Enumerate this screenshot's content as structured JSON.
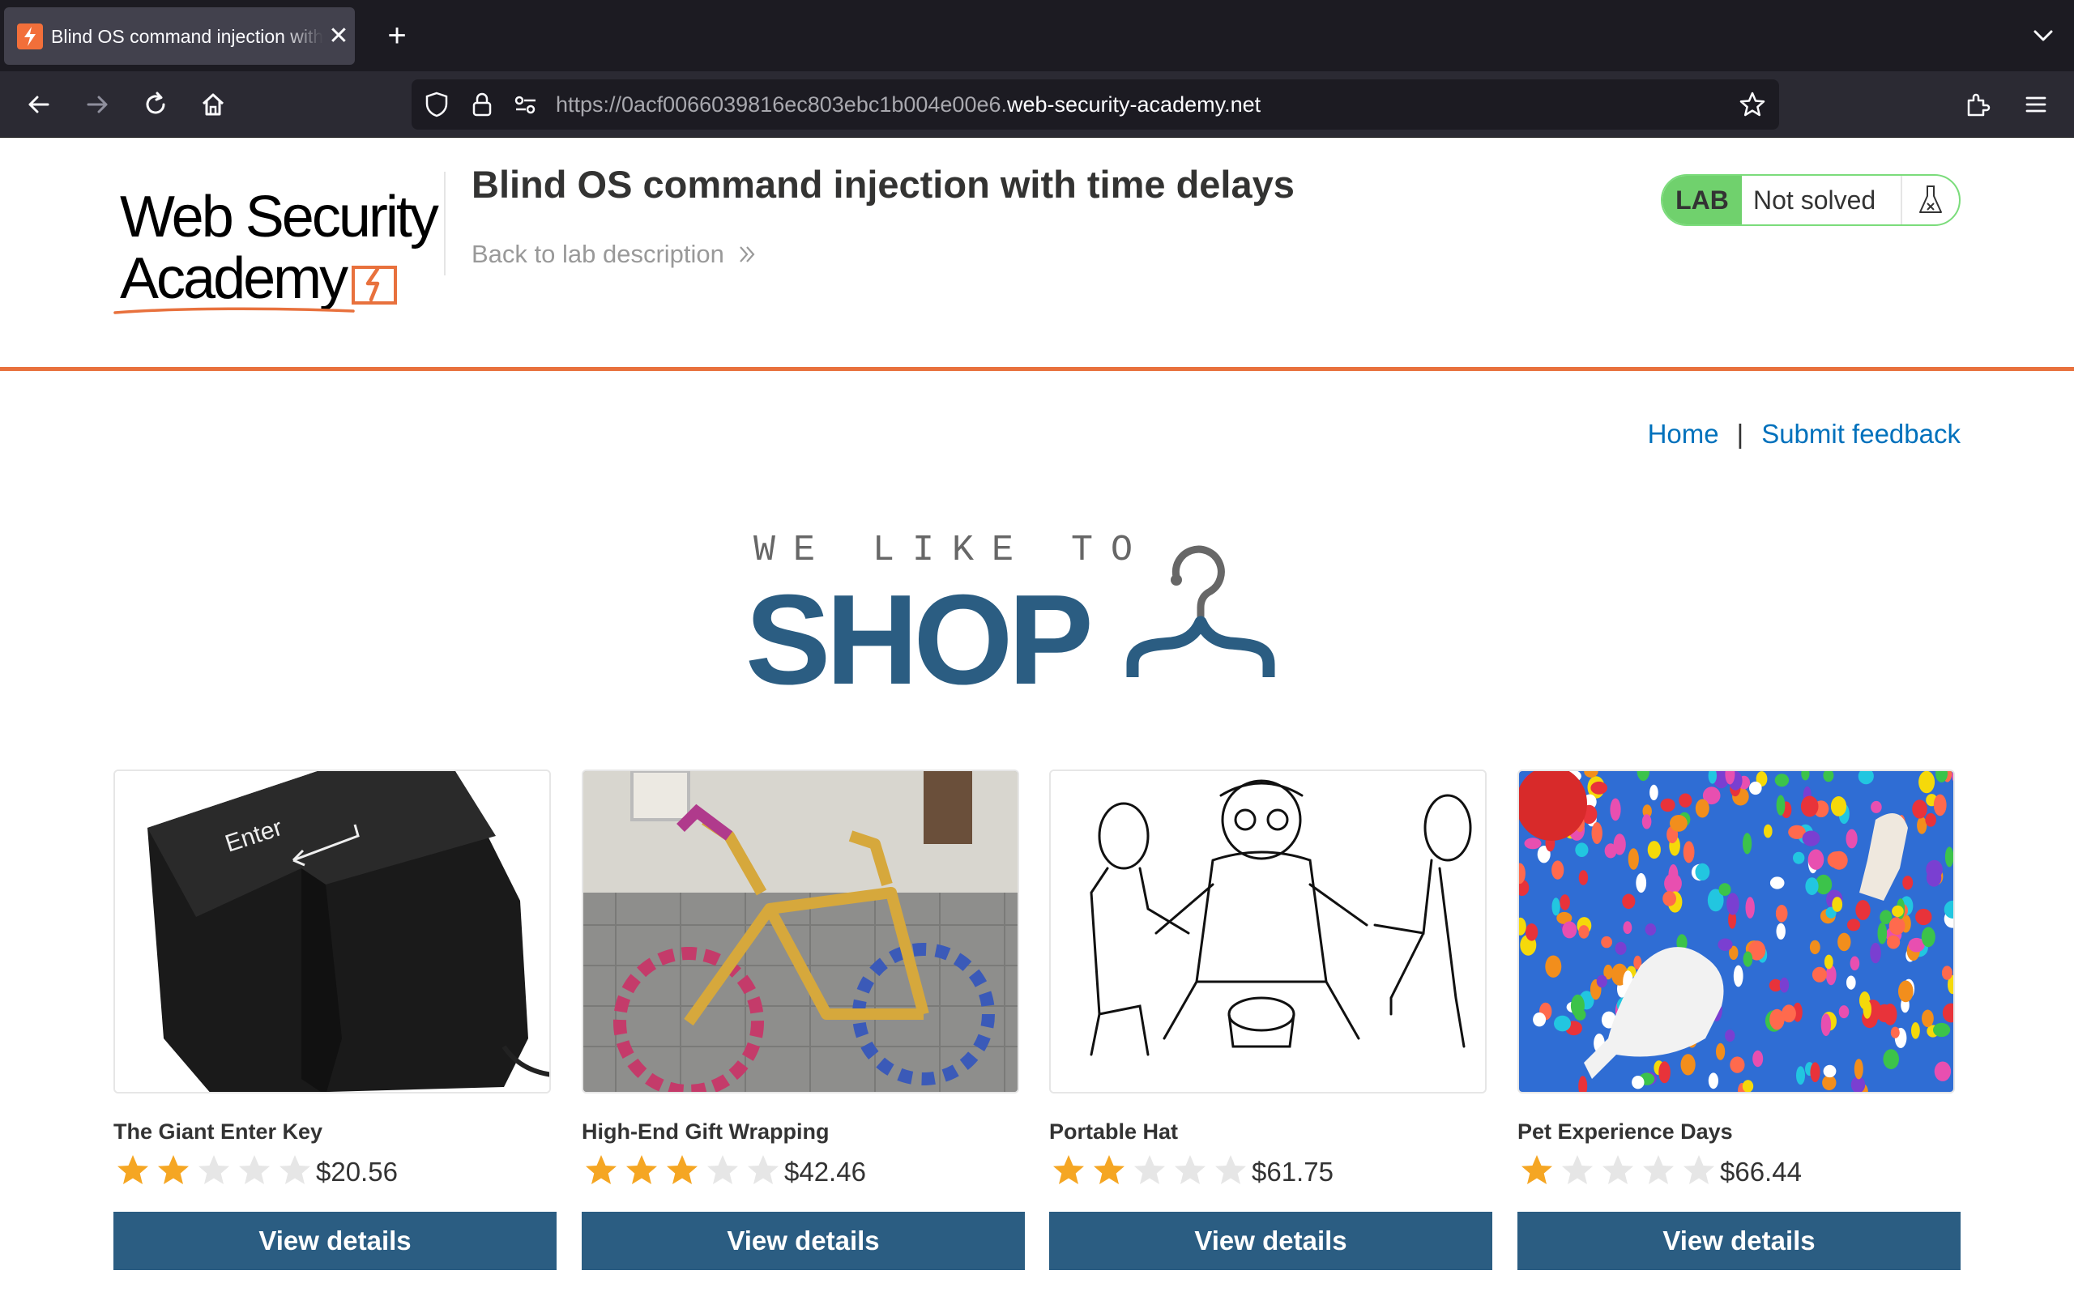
{
  "browser": {
    "tab_title": "Blind OS command injection with time delays",
    "url_prefix": "https://0acf0066039816ec803ebc1b004e00e6.",
    "url_host": "web-security-academy.net"
  },
  "lab": {
    "logo_line1": "Web Security",
    "logo_line2": "Academy",
    "title": "Blind OS command injection with time delays",
    "back_link": "Back to lab description",
    "badge": "LAB",
    "status": "Not solved"
  },
  "nav": {
    "home": "Home",
    "separator": "|",
    "feedback": "Submit feedback"
  },
  "hero": {
    "small": "WE LIKE TO",
    "big": "SHOP"
  },
  "products": [
    {
      "name": "The Giant Enter Key",
      "price": "$20.56",
      "rating": 2,
      "button": "View details"
    },
    {
      "name": "High-End Gift Wrapping",
      "price": "$42.46",
      "rating": 3,
      "button": "View details"
    },
    {
      "name": "Portable Hat",
      "price": "$61.75",
      "rating": 2,
      "button": "View details"
    },
    {
      "name": "Pet Experience Days",
      "price": "$66.44",
      "rating": 1,
      "button": "View details"
    }
  ],
  "colors": {
    "accent_orange": "#e8713d",
    "brand_blue": "#2b5d82",
    "link_blue": "#0071bc",
    "lab_green": "#70d16d",
    "star_filled": "#f5a623",
    "star_empty": "#e6e6e6"
  },
  "icons": {
    "back": "arrow-left-icon",
    "forward": "arrow-right-icon",
    "reload": "reload-icon",
    "home": "home-icon",
    "shield": "shield-icon",
    "lock": "lock-icon",
    "permissions": "permissions-icon",
    "bookmark": "star-outline-icon",
    "extensions": "puzzle-icon",
    "menu": "hamburger-icon",
    "flask": "flask-icon",
    "hanger": "hanger-icon"
  }
}
